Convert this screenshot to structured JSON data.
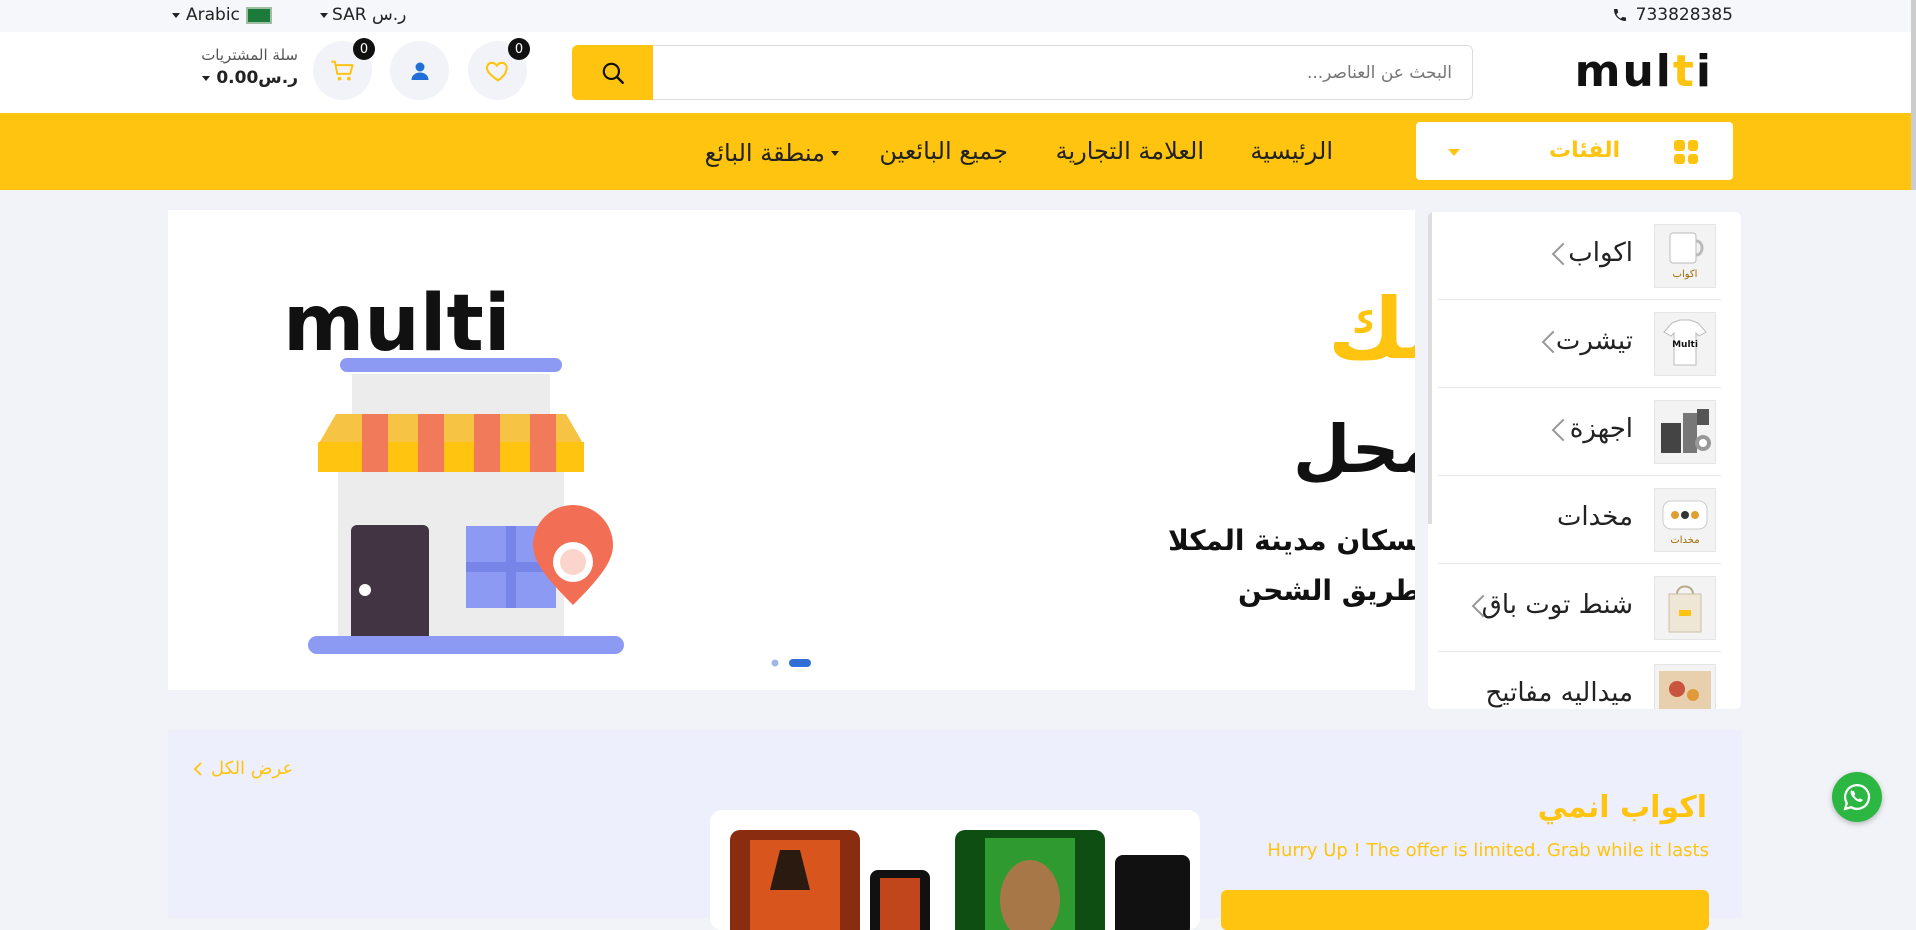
{
  "topbar": {
    "phone": "733828385",
    "currency": "SAR ر.س",
    "language": "Arabic"
  },
  "header": {
    "logo_text": "multi",
    "search_placeholder": "البحث عن العناصر...",
    "wishlist_count": "0",
    "cart_count": "0",
    "cart_label": "سلة المشتريات",
    "cart_total": "0.00ر.س"
  },
  "nav": {
    "categories_label": "الفئات",
    "items": [
      "الرئيسية",
      "العلامة التجارية",
      "جميع البائعين",
      "منطقة البائع"
    ]
  },
  "sidebar": {
    "categories": [
      {
        "name": "اكواب",
        "thumb_label": "اكواب",
        "has_sub": true
      },
      {
        "name": "تيشرت",
        "thumb_label": "Multi",
        "has_sub": true
      },
      {
        "name": "اجهزة",
        "thumb_label": "",
        "has_sub": true
      },
      {
        "name": "مخدات",
        "thumb_label": "مخدات",
        "has_sub": false
      },
      {
        "name": "شنط توت باق",
        "thumb_label": "",
        "has_sub": true
      },
      {
        "name": "ميداليه مفاتيح",
        "thumb_label": "",
        "has_sub": false
      }
    ]
  },
  "banner": {
    "brand": "multi",
    "headline": "اطلب من بيتك",
    "subheadline": "واستلم من المحل",
    "line1": "لسكان مدينة المكلا",
    "line2": "والباقي المحافظات عن طريق الشحن",
    "slide_count": 2,
    "active_slide": 2
  },
  "promo": {
    "title": "اكواب انمي",
    "subtitle": "Hurry Up ! The offer is limited. Grab while it lasts",
    "view_all": "عرض الكل"
  },
  "colors": {
    "accent": "#fec40f",
    "dark": "#111111",
    "whatsapp": "#2cb742"
  }
}
